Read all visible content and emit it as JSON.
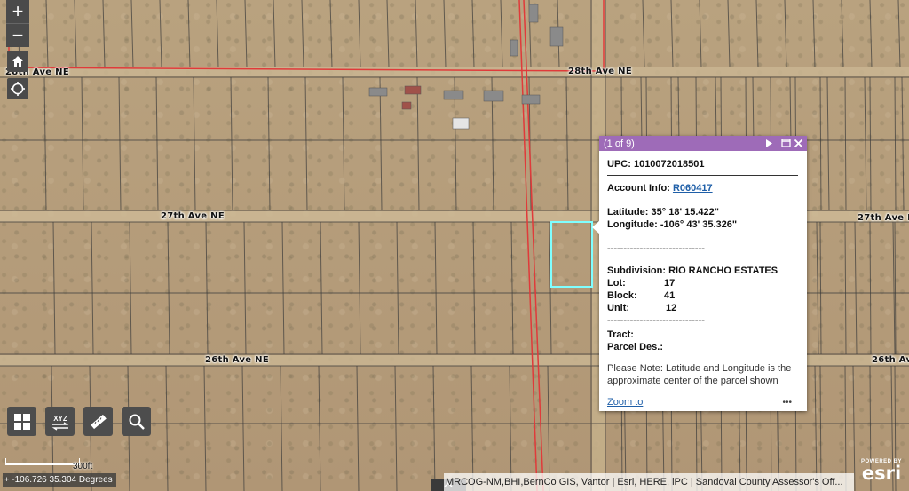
{
  "map": {
    "roads": {
      "r28": "28th Ave NE",
      "r27": "27th Ave NE",
      "r26": "26th Ave NE"
    },
    "scale_label": "300ft",
    "coordinates": "-106.726 35.304 Degrees",
    "attribution": "MRCOG-NM,BHI,BernCo GIS, Vantor | Esri, HERE, iPC | Sandoval County Assessor's Off...",
    "logo_small": "POWERED BY",
    "logo_big": "esri",
    "colors": {
      "popup_header": "#9e6bb8",
      "parcel_highlight": "#7fffff",
      "county_line": "#e03a3a",
      "link": "#1f5fa8"
    }
  },
  "controls": {
    "zoom_in": "+",
    "zoom_out": "−",
    "home_icon": "home-icon",
    "locate_icon": "locate-icon",
    "tools": [
      "basemap-gallery-icon",
      "xyz-coordinate-icon",
      "measure-ruler-icon",
      "search-icon"
    ],
    "xyz_label": "XYZ"
  },
  "popup": {
    "header": "(1 of 9)",
    "upc_label": "UPC:",
    "upc_value": "1010072018501",
    "account_label": "Account Info:",
    "account_value": "R060417",
    "latitude_label": "Latitude:",
    "latitude_value": "35° 18' 15.422\"",
    "longitude_label": "Longitude:",
    "longitude_value": "-106° 43' 35.326\"",
    "separator_1": "------------------------------",
    "subdivision_label": "Subdivision:",
    "subdivision_value": "RIO RANCHO ESTATES",
    "lot_label": "Lot:",
    "lot_value": "17",
    "block_label": "Block:",
    "block_value": "41",
    "unit_label": "Unit:",
    "unit_value": "12",
    "separator_2": "------------------------------",
    "tract_label": "Tract:",
    "parcel_des_label": "Parcel Des.:",
    "note": "Please Note: Latitude and Longitude is the approximate center of the parcel shown",
    "zoom_to": "Zoom to",
    "more": "•••"
  }
}
